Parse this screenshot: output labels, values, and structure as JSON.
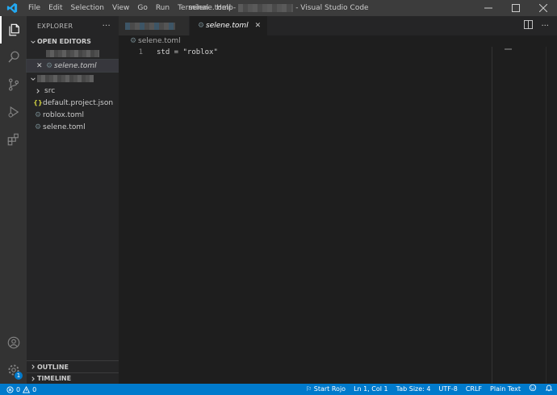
{
  "titlebar": {
    "menu": [
      "File",
      "Edit",
      "Selection",
      "View",
      "Go",
      "Run",
      "Terminal",
      "Help"
    ],
    "title_prefix": "selene.toml -",
    "title_suffix": "- Visual Studio Code"
  },
  "sidebar": {
    "title": "EXPLORER",
    "more": "···",
    "open_editors_label": "OPEN EDITORS",
    "open_editor_file": "selene.toml",
    "files": [
      {
        "name": "src",
        "kind": "folder"
      },
      {
        "name": "default.project.json",
        "kind": "json"
      },
      {
        "name": "roblox.toml",
        "kind": "toml"
      },
      {
        "name": "selene.toml",
        "kind": "toml"
      }
    ],
    "outline_label": "OUTLINE",
    "timeline_label": "TIMELINE"
  },
  "editor": {
    "active_tab": "selene.toml",
    "breadcrumb": "selene.toml",
    "lines": [
      {
        "number": "1",
        "text": "std = \"roblox\""
      }
    ]
  },
  "activitybar": {
    "settings_badge": "1"
  },
  "statusbar": {
    "errors": "0",
    "warnings": "0",
    "rojo": "Start Rojo",
    "position": "Ln 1, Col 1",
    "tab_size": "Tab Size: 4",
    "encoding": "UTF-8",
    "eol": "CRLF",
    "language": "Plain Text"
  },
  "colors": {
    "accent": "#007acc",
    "titlebar": "#3c3c3c",
    "activitybar": "#333333",
    "sidebar": "#252526",
    "editor": "#1e1e1e"
  }
}
